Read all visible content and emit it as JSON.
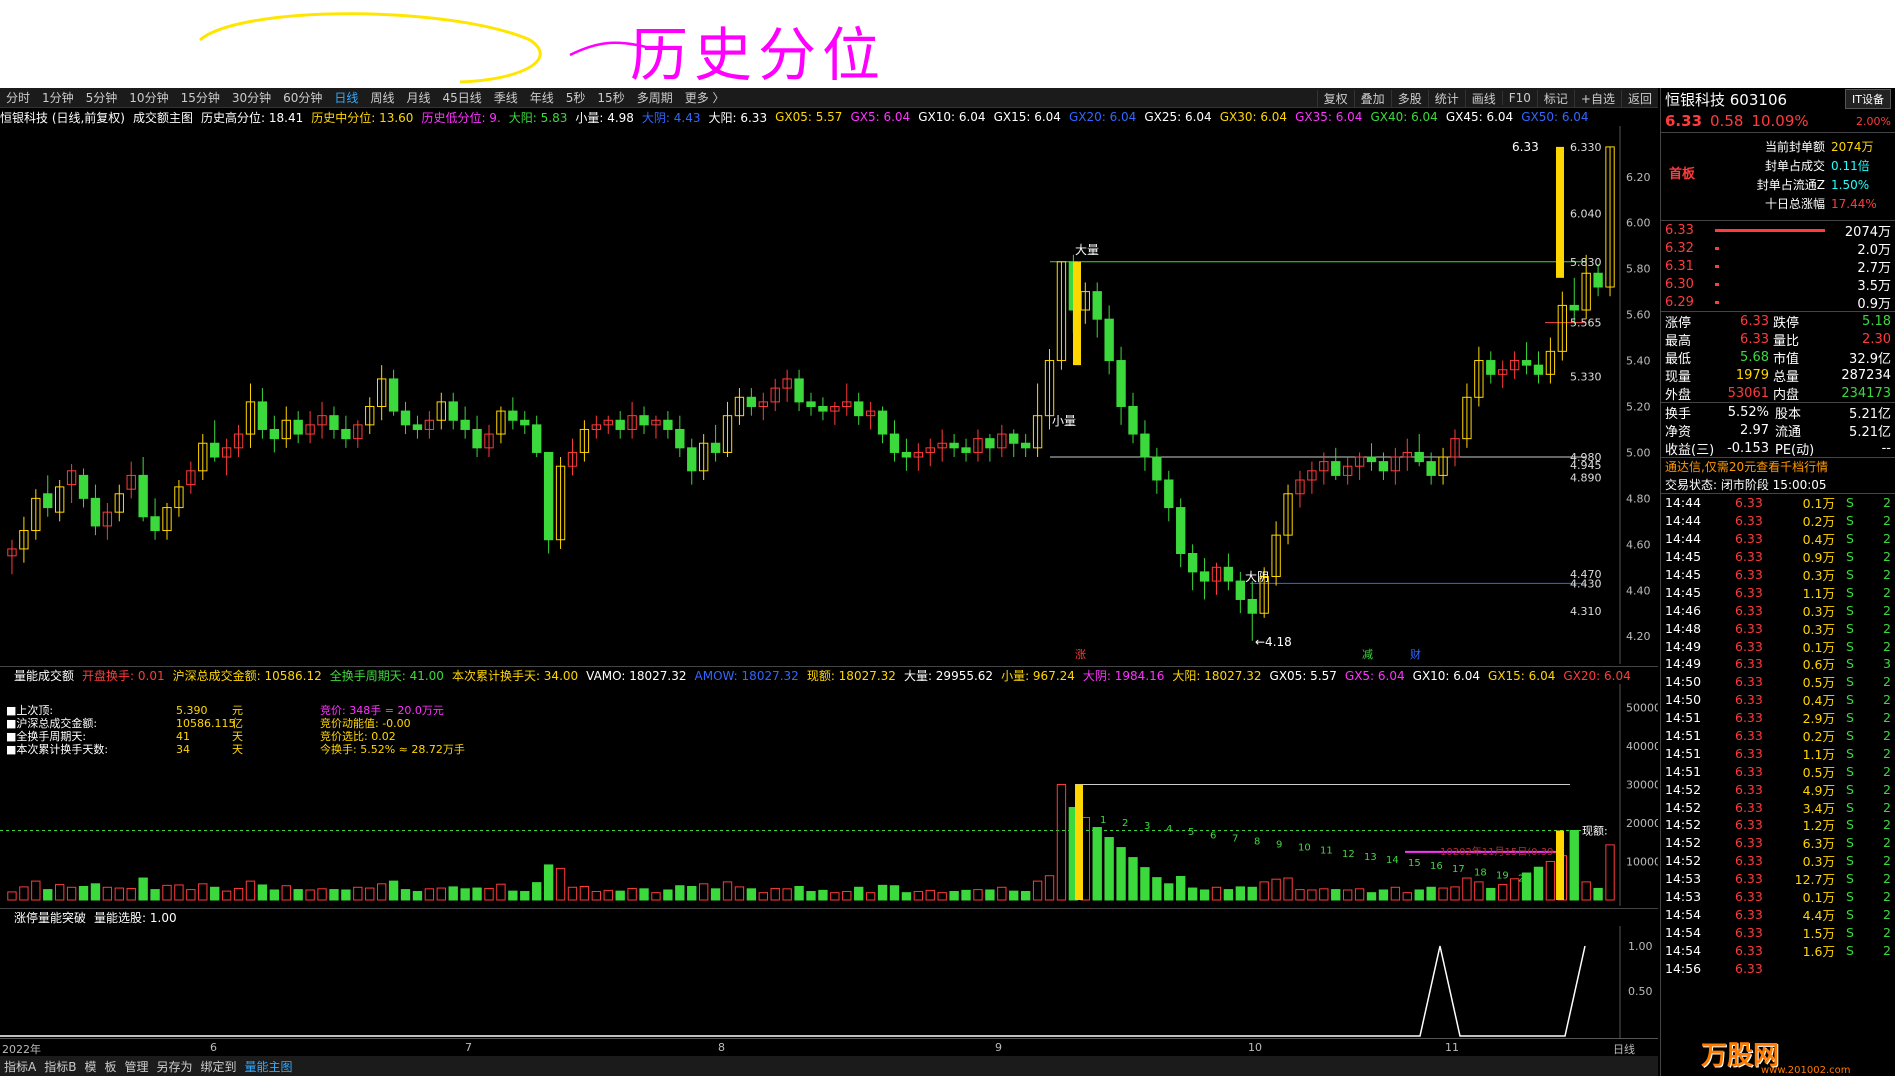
{
  "annotation_text": "历史分位",
  "toolbar": {
    "periods": [
      "分时",
      "1分钟",
      "5分钟",
      "10分钟",
      "15分钟",
      "30分钟",
      "60分钟",
      "日线",
      "周线",
      "月线",
      "45日线",
      "季线",
      "年线",
      "5秒",
      "15秒",
      "多周期",
      "更多 〉"
    ],
    "right": [
      "复权",
      "叠加",
      "多股",
      "统计",
      "画线",
      "F10",
      "标记",
      "+自选",
      "返回"
    ]
  },
  "info": {
    "title": "恒银科技 (日线,前复权)",
    "indicator": "成交额主图",
    "hist_high": "历史高分位: 18.41",
    "hist_mid": "历史中分位: 13.60",
    "hist_low": "历史低分位: 9.",
    "dayang": "大阳: 5.83",
    "xiaoliang": "小量: 4.98",
    "dayin": "大阴: 4.43",
    "dayang2": "大阳: 6.33",
    "gx": [
      {
        "t": "GX05: 5.57",
        "c": "#ffd700"
      },
      {
        "t": "GX5: 6.04",
        "c": "#f3f"
      },
      {
        "t": "GX10: 6.04",
        "c": "#fff"
      },
      {
        "t": "GX15: 6.04",
        "c": "#fff"
      },
      {
        "t": "GX20: 6.04",
        "c": "#36f"
      },
      {
        "t": "GX25: 6.04",
        "c": "#fff"
      },
      {
        "t": "GX30: 6.04",
        "c": "#ffd700"
      },
      {
        "t": "GX35: 6.04",
        "c": "#f3f"
      },
      {
        "t": "GX40: 6.04",
        "c": "#3cd93c"
      },
      {
        "t": "GX45: 6.04",
        "c": "#fff"
      },
      {
        "t": "GX50: 6.04",
        "c": "#36f"
      }
    ]
  },
  "price_axis": [
    "6.20",
    "6.00",
    "5.80",
    "5.60",
    "5.40",
    "5.20",
    "5.00",
    "4.80",
    "4.60",
    "4.40",
    "4.20"
  ],
  "price_marks": [
    "6.330",
    "6.040",
    "5.830",
    "5.565",
    "5.330",
    "4.980",
    "4.945",
    "4.890",
    "4.470",
    "4.430",
    "4.310"
  ],
  "chart_labels": {
    "dayang": "大量",
    "xiaoliang": "小量",
    "dayin": "大阴",
    "low": "←4.18",
    "high": "6.33",
    "zhang": "涨",
    "jian": "减",
    "cai": "财"
  },
  "volume": {
    "header": [
      "量能成交额",
      "开盘换手: 0.01",
      "沪深总成交金额: 10586.12",
      "全换手周期天: 41.00",
      "本次累计换手天: 34.00",
      "VAMO: 18027.32",
      "AMOW: 18027.32",
      "现额: 18027.32",
      "大量: 29955.62",
      "小量: 967.24",
      "大阴: 1984.16",
      "大阳: 18027.32",
      "GX05: 5.57",
      "GX5: 6.04",
      "GX10: 6.04",
      "GX15: 6.04",
      "GX20: 6.04"
    ],
    "axis": [
      "50000",
      "40000",
      "30000",
      "20000",
      "10000"
    ],
    "info_left": [
      [
        "上次顶:",
        "5.390",
        "元"
      ],
      [
        "沪深总成交金额:",
        "10586.115",
        "亿"
      ],
      [
        "全换手周期天:",
        "41",
        "天"
      ],
      [
        "本次累计换手天数:",
        "34",
        "天"
      ]
    ],
    "info_right": [
      "竞价: 348手 = 20.0万元",
      "竞价动能值: -0.00",
      "竞价选比: 0.02",
      "今换手: 5.52%  ≈  28.72万手"
    ],
    "now_label": "现额:",
    "note": "10202年11月15日(0.39",
    "small_nums": [
      "1",
      "2",
      "3",
      "4",
      "5",
      "6",
      "7",
      "8",
      "9",
      "10",
      "11",
      "12",
      "13",
      "14",
      "15",
      "16",
      "17",
      "18",
      "19",
      "20"
    ]
  },
  "indicator2": {
    "name": "涨停量能突破",
    "value": "量能选股: 1.00",
    "axis": [
      "1.00",
      "0.50"
    ]
  },
  "dates": [
    "2022年",
    "6",
    "7",
    "8",
    "9",
    "10",
    "11",
    "日线"
  ],
  "tabs": [
    "指标A",
    "指标B",
    "模",
    "板",
    "管理",
    "另存为",
    "绑定到",
    "量能主图"
  ],
  "side": {
    "name": "恒银科技 603106",
    "tag": "IT设备",
    "price": "6.33",
    "chg": "0.58",
    "pct": "10.09%",
    "pct2": "2.00%",
    "firstboard": "首板",
    "seal": [
      [
        "当前封单额",
        "2074万"
      ],
      [
        "封单占成交",
        "0.11倍"
      ],
      [
        "封单占流通Z",
        "1.50%"
      ],
      [
        "十日总涨幅",
        "17.44%"
      ]
    ],
    "bids": [
      [
        "6.33",
        "2074万"
      ],
      [
        "6.32",
        "2.0万"
      ],
      [
        "6.31",
        "2.7万"
      ],
      [
        "6.30",
        "3.5万"
      ],
      [
        "6.29",
        "0.9万"
      ]
    ],
    "stats": [
      [
        "涨停",
        "6.33",
        "跌停",
        "5.18"
      ],
      [
        "最高",
        "6.33",
        "量比",
        "2.30"
      ],
      [
        "最低",
        "5.68",
        "市值",
        "32.9亿"
      ],
      [
        "现量",
        "1979",
        "总量",
        "287234"
      ],
      [
        "外盘",
        "53061",
        "内盘",
        "234173"
      ]
    ],
    "stats2": [
      [
        "换手",
        "5.52%",
        "股本",
        "5.21亿"
      ],
      [
        "净资",
        "2.97",
        "流通",
        "5.21亿"
      ],
      [
        "收益(三)",
        "-0.153",
        "PE(动)",
        "--"
      ]
    ],
    "promo": "通达信,仅需20元查看千档行情",
    "status": "交易状态: 闭市阶段 15:00:05",
    "ticks": [
      [
        "14:44",
        "6.33",
        "0.1万",
        "S",
        "2"
      ],
      [
        "14:44",
        "6.33",
        "0.2万",
        "S",
        "2"
      ],
      [
        "14:44",
        "6.33",
        "0.4万",
        "S",
        "2"
      ],
      [
        "14:45",
        "6.33",
        "0.9万",
        "S",
        "2"
      ],
      [
        "14:45",
        "6.33",
        "0.3万",
        "S",
        "2"
      ],
      [
        "14:45",
        "6.33",
        "1.1万",
        "S",
        "2"
      ],
      [
        "14:46",
        "6.33",
        "0.3万",
        "S",
        "2"
      ],
      [
        "14:48",
        "6.33",
        "0.3万",
        "S",
        "2"
      ],
      [
        "14:49",
        "6.33",
        "0.1万",
        "S",
        "2"
      ],
      [
        "14:49",
        "6.33",
        "0.6万",
        "S",
        "3"
      ],
      [
        "14:50",
        "6.33",
        "0.5万",
        "S",
        "2"
      ],
      [
        "14:50",
        "6.33",
        "0.4万",
        "S",
        "2"
      ],
      [
        "14:51",
        "6.33",
        "2.9万",
        "S",
        "2"
      ],
      [
        "14:51",
        "6.33",
        "0.2万",
        "S",
        "2"
      ],
      [
        "14:51",
        "6.33",
        "1.1万",
        "S",
        "2"
      ],
      [
        "14:51",
        "6.33",
        "0.5万",
        "S",
        "2"
      ],
      [
        "14:52",
        "6.33",
        "4.9万",
        "S",
        "2"
      ],
      [
        "14:52",
        "6.33",
        "3.4万",
        "S",
        "2"
      ],
      [
        "14:52",
        "6.33",
        "1.2万",
        "S",
        "2"
      ],
      [
        "14:52",
        "6.33",
        "6.3万",
        "S",
        "2"
      ],
      [
        "14:52",
        "6.33",
        "0.3万",
        "S",
        "2"
      ],
      [
        "14:53",
        "6.33",
        "12.7万",
        "S",
        "2"
      ],
      [
        "14:53",
        "6.33",
        "0.1万",
        "S",
        "2"
      ],
      [
        "14:54",
        "6.33",
        "4.4万",
        "S",
        "2"
      ],
      [
        "14:54",
        "6.33",
        "1.5万",
        "S",
        "2"
      ],
      [
        "14:54",
        "6.33",
        "1.6万",
        "S",
        "2"
      ],
      [
        "14:56",
        "6.33",
        "",
        "",
        ""
      ]
    ],
    "watermark": "万股网",
    "watermark_url": "www.201002.com"
  },
  "chart_data": {
    "type": "candlestick",
    "ylim": [
      4.14,
      6.36
    ],
    "candles": [
      [
        4.55,
        4.62,
        4.47,
        4.58
      ],
      [
        4.58,
        4.72,
        4.52,
        4.66
      ],
      [
        4.66,
        4.84,
        4.62,
        4.8
      ],
      [
        4.82,
        4.9,
        4.72,
        4.76
      ],
      [
        4.74,
        4.88,
        4.7,
        4.85
      ],
      [
        4.86,
        4.95,
        4.78,
        4.92
      ],
      [
        4.9,
        4.93,
        4.76,
        4.8
      ],
      [
        4.8,
        4.86,
        4.64,
        4.68
      ],
      [
        4.68,
        4.78,
        4.62,
        4.74
      ],
      [
        4.74,
        4.86,
        4.7,
        4.82
      ],
      [
        4.84,
        4.96,
        4.8,
        4.9
      ],
      [
        4.9,
        4.98,
        4.7,
        4.72
      ],
      [
        4.72,
        4.8,
        4.62,
        4.66
      ],
      [
        4.66,
        4.78,
        4.62,
        4.76
      ],
      [
        4.76,
        4.88,
        4.72,
        4.85
      ],
      [
        4.86,
        4.96,
        4.82,
        4.92
      ],
      [
        4.92,
        5.08,
        4.88,
        5.04
      ],
      [
        5.04,
        5.14,
        4.96,
        4.98
      ],
      [
        4.98,
        5.06,
        4.9,
        5.02
      ],
      [
        5.02,
        5.12,
        4.98,
        5.08
      ],
      [
        5.08,
        5.3,
        5.02,
        5.22
      ],
      [
        5.22,
        5.28,
        5.06,
        5.1
      ],
      [
        5.1,
        5.16,
        5.0,
        5.06
      ],
      [
        5.06,
        5.2,
        5.02,
        5.14
      ],
      [
        5.14,
        5.18,
        5.04,
        5.08
      ],
      [
        5.08,
        5.18,
        5.04,
        5.12
      ],
      [
        5.12,
        5.22,
        5.06,
        5.16
      ],
      [
        5.16,
        5.2,
        5.06,
        5.1
      ],
      [
        5.1,
        5.16,
        5.02,
        5.06
      ],
      [
        5.06,
        5.14,
        5.02,
        5.12
      ],
      [
        5.12,
        5.24,
        5.08,
        5.2
      ],
      [
        5.2,
        5.38,
        5.14,
        5.32
      ],
      [
        5.32,
        5.36,
        5.16,
        5.18
      ],
      [
        5.18,
        5.22,
        5.08,
        5.12
      ],
      [
        5.12,
        5.16,
        5.06,
        5.1
      ],
      [
        5.1,
        5.18,
        5.06,
        5.14
      ],
      [
        5.14,
        5.26,
        5.1,
        5.22
      ],
      [
        5.22,
        5.26,
        5.1,
        5.14
      ],
      [
        5.14,
        5.2,
        5.06,
        5.1
      ],
      [
        5.1,
        5.16,
        4.98,
        5.02
      ],
      [
        5.02,
        5.12,
        4.98,
        5.08
      ],
      [
        5.08,
        5.2,
        5.04,
        5.18
      ],
      [
        5.18,
        5.24,
        5.1,
        5.14
      ],
      [
        5.14,
        5.18,
        5.08,
        5.12
      ],
      [
        5.12,
        5.16,
        4.98,
        5.0
      ],
      [
        5.0,
        4.88,
        4.56,
        4.62
      ],
      [
        4.62,
        4.98,
        4.58,
        4.94
      ],
      [
        4.94,
        5.06,
        4.9,
        5.0
      ],
      [
        5.0,
        5.14,
        4.96,
        5.1
      ],
      [
        5.1,
        5.16,
        5.06,
        5.12
      ],
      [
        5.12,
        5.16,
        5.08,
        5.14
      ],
      [
        5.14,
        5.18,
        5.06,
        5.1
      ],
      [
        5.1,
        5.22,
        5.06,
        5.16
      ],
      [
        5.16,
        5.2,
        5.08,
        5.12
      ],
      [
        5.12,
        5.16,
        5.06,
        5.14
      ],
      [
        5.14,
        5.18,
        5.06,
        5.1
      ],
      [
        5.1,
        5.16,
        4.98,
        5.02
      ],
      [
        5.02,
        5.06,
        4.86,
        4.92
      ],
      [
        4.92,
        5.08,
        4.88,
        5.04
      ],
      [
        5.04,
        5.12,
        4.96,
        5.0
      ],
      [
        5.0,
        5.22,
        4.98,
        5.16
      ],
      [
        5.16,
        5.28,
        5.12,
        5.24
      ],
      [
        5.24,
        5.28,
        5.16,
        5.2
      ],
      [
        5.2,
        5.26,
        5.14,
        5.22
      ],
      [
        5.22,
        5.32,
        5.18,
        5.28
      ],
      [
        5.28,
        5.36,
        5.22,
        5.32
      ],
      [
        5.32,
        5.36,
        5.18,
        5.22
      ],
      [
        5.22,
        5.26,
        5.16,
        5.2
      ],
      [
        5.2,
        5.24,
        5.14,
        5.18
      ],
      [
        5.18,
        5.22,
        5.12,
        5.2
      ],
      [
        5.2,
        5.3,
        5.16,
        5.22
      ],
      [
        5.22,
        5.26,
        5.12,
        5.16
      ],
      [
        5.16,
        5.22,
        5.1,
        5.18
      ],
      [
        5.18,
        5.2,
        5.04,
        5.08
      ],
      [
        5.08,
        5.14,
        4.96,
        5.0
      ],
      [
        5.0,
        5.06,
        4.92,
        4.98
      ],
      [
        4.98,
        5.04,
        4.92,
        5.0
      ],
      [
        5.0,
        5.06,
        4.94,
        5.02
      ],
      [
        5.02,
        5.1,
        4.96,
        5.04
      ],
      [
        5.04,
        5.08,
        4.98,
        5.02
      ],
      [
        5.02,
        5.06,
        4.96,
        5.0
      ],
      [
        5.0,
        5.1,
        4.96,
        5.06
      ],
      [
        5.06,
        5.08,
        4.96,
        5.02
      ],
      [
        5.02,
        5.12,
        4.98,
        5.08
      ],
      [
        5.08,
        5.1,
        4.98,
        5.04
      ],
      [
        5.04,
        5.08,
        4.98,
        5.02
      ],
      [
        5.02,
        5.3,
        4.98,
        5.16
      ],
      [
        5.16,
        5.45,
        5.1,
        5.4
      ],
      [
        5.4,
        5.83,
        5.36,
        5.83
      ],
      [
        5.83,
        5.86,
        5.52,
        5.62
      ],
      [
        5.62,
        5.74,
        5.56,
        5.7
      ],
      [
        5.7,
        5.74,
        5.5,
        5.58
      ],
      [
        5.58,
        5.64,
        5.34,
        5.4
      ],
      [
        5.4,
        5.46,
        5.12,
        5.2
      ],
      [
        5.2,
        5.26,
        5.04,
        5.08
      ],
      [
        5.08,
        5.14,
        4.92,
        4.98
      ],
      [
        4.98,
        5.02,
        4.82,
        4.88
      ],
      [
        4.88,
        4.92,
        4.7,
        4.76
      ],
      [
        4.76,
        4.8,
        4.5,
        4.56
      ],
      [
        4.56,
        4.6,
        4.4,
        4.48
      ],
      [
        4.48,
        4.54,
        4.36,
        4.44
      ],
      [
        4.44,
        4.52,
        4.38,
        4.5
      ],
      [
        4.5,
        4.56,
        4.4,
        4.44
      ],
      [
        4.44,
        4.48,
        4.3,
        4.36
      ],
      [
        4.36,
        4.44,
        4.18,
        4.3
      ],
      [
        4.3,
        4.5,
        4.28,
        4.46
      ],
      [
        4.46,
        4.7,
        4.42,
        4.64
      ],
      [
        4.64,
        4.86,
        4.6,
        4.82
      ],
      [
        4.82,
        4.92,
        4.76,
        4.88
      ],
      [
        4.88,
        4.96,
        4.82,
        4.92
      ],
      [
        4.92,
        5.0,
        4.86,
        4.96
      ],
      [
        4.96,
        5.02,
        4.88,
        4.9
      ],
      [
        4.9,
        4.98,
        4.86,
        4.94
      ],
      [
        4.94,
        5.0,
        4.88,
        4.98
      ],
      [
        4.98,
        5.04,
        4.92,
        4.96
      ],
      [
        4.96,
        5.0,
        4.88,
        4.92
      ],
      [
        4.92,
        5.02,
        4.86,
        4.98
      ],
      [
        4.98,
        5.06,
        4.92,
        5.0
      ],
      [
        5.0,
        5.08,
        4.94,
        4.96
      ],
      [
        4.96,
        5.0,
        4.86,
        4.9
      ],
      [
        4.9,
        5.02,
        4.86,
        4.98
      ],
      [
        4.98,
        5.1,
        4.94,
        5.06
      ],
      [
        5.06,
        5.3,
        5.02,
        5.24
      ],
      [
        5.24,
        5.46,
        5.2,
        5.4
      ],
      [
        5.4,
        5.44,
        5.3,
        5.34
      ],
      [
        5.34,
        5.4,
        5.28,
        5.36
      ],
      [
        5.36,
        5.44,
        5.32,
        5.4
      ],
      [
        5.4,
        5.48,
        5.34,
        5.38
      ],
      [
        5.38,
        5.44,
        5.3,
        5.34
      ],
      [
        5.34,
        5.5,
        5.3,
        5.44
      ],
      [
        5.44,
        5.7,
        5.4,
        5.64
      ],
      [
        5.64,
        5.76,
        5.56,
        5.62
      ],
      [
        5.62,
        5.86,
        5.58,
        5.78
      ],
      [
        5.78,
        5.82,
        5.68,
        5.72
      ],
      [
        5.72,
        6.33,
        5.68,
        6.33
      ]
    ]
  }
}
